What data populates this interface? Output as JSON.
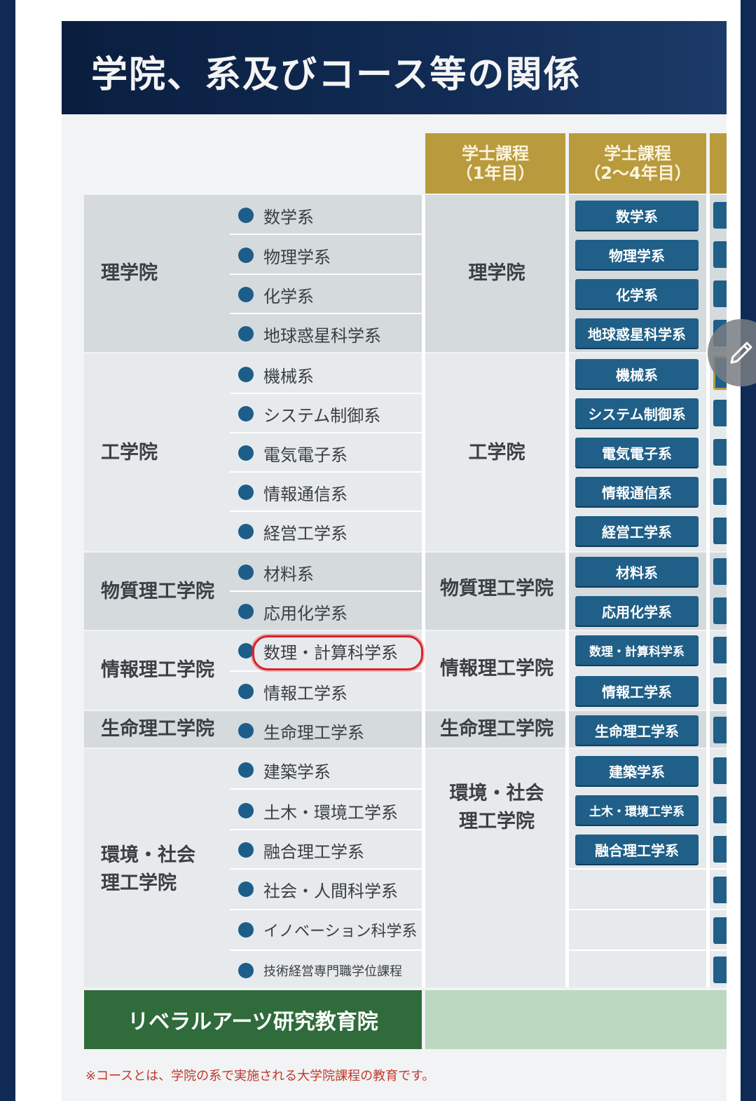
{
  "title": "学院、系及びコース等の関係",
  "headers": [
    {
      "line1": "学士課程",
      "line2": "（1年目）"
    },
    {
      "line1": "学士課程",
      "line2": "（2～4年目）"
    }
  ],
  "groups": [
    {
      "school": "理学院",
      "departments": [
        "数学系",
        "物理学系",
        "化学系",
        "地球惑星科学系"
      ]
    },
    {
      "school": "工学院",
      "departments": [
        "機械系",
        "システム制御系",
        "電気電子系",
        "情報通信系",
        "経営工学系"
      ]
    },
    {
      "school": "物質理工学院",
      "departments": [
        "材料系",
        "応用化学系"
      ]
    },
    {
      "school": "情報理工学院",
      "departments": [
        "数理・計算科学系",
        "情報工学系"
      ]
    },
    {
      "school": "生命理工学院",
      "departments": [
        "生命理工学系"
      ]
    },
    {
      "school_line1": "環境・社会",
      "school_line2": "理工学院",
      "departments": [
        "建築学系",
        "土木・環境工学系",
        "融合理工学系",
        "社会・人間科学系",
        "イノベーション科学系",
        "技術経営専門職学位課程"
      ]
    }
  ],
  "liberal_arts": "リベラルアーツ研究教育院",
  "footnote": "※コースとは、学院の系で実施される大学院課程の教育です。",
  "annotation_color": "#d8222a",
  "accent_gold": "#b99a3c",
  "pill_blue": "#1f5f88"
}
